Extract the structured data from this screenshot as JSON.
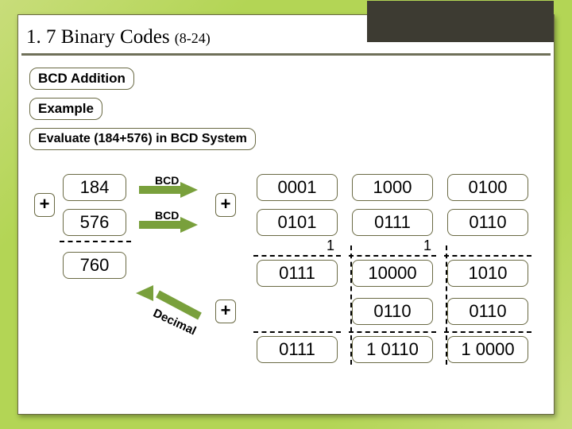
{
  "title": {
    "main": "1. 7 Binary Codes ",
    "sub": "(8-24)"
  },
  "labels": {
    "bcd_addition": "BCD Addition",
    "example": "Example",
    "problem": "Evaluate (184+576) in BCD System",
    "bcd": "BCD",
    "decimal": "Decimal",
    "plus": "+"
  },
  "dec": {
    "a": "184",
    "b": "576",
    "sum": "760"
  },
  "row1": {
    "c1": "0001",
    "c2": "1000",
    "c3": "0100"
  },
  "row2": {
    "c1": "0101",
    "c2": "0111",
    "c3": "0110"
  },
  "carry": {
    "c1": "1",
    "c2": "1"
  },
  "row3": {
    "c1": "0111",
    "c2": "10000",
    "c3": "1010"
  },
  "row4": {
    "c2": "0110",
    "c3": "0110"
  },
  "row5": {
    "c1": "0111",
    "c2": "1 0110",
    "c3": "1 0000"
  }
}
